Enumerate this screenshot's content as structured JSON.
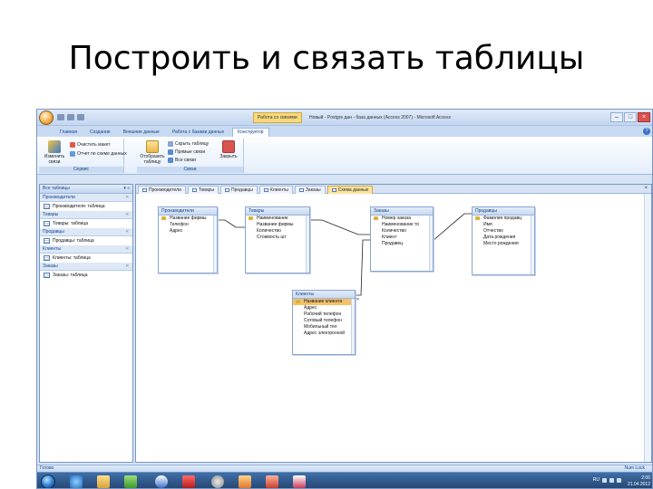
{
  "slide": {
    "title": "Построить и связать таблицы"
  },
  "window": {
    "context_tab_title": "Работа со связями",
    "title": "Новый - Postgre дан - база данных (Access 2007) - Microsoft Access",
    "controls": {
      "minimize": "–",
      "maximize": "□",
      "close": "×"
    }
  },
  "ribbon": {
    "tabs": [
      "Главная",
      "Создание",
      "Внешние данные",
      "Работа с базами данных",
      "Конструктор"
    ],
    "active_tab_index": 4,
    "help": "?",
    "groups": {
      "service": {
        "label": "Сервис",
        "change_links": "Изменить связи",
        "clear_layout": "Очистить макет",
        "relationship_report": "Отчет по схеме данных"
      },
      "relationships": {
        "label": "Связи",
        "show_table": "Отобразить таблицу",
        "hide_table": "Скрыть таблицу",
        "direct_links": "Прямые связи",
        "all_links": "Все связи",
        "close": "Закрыть"
      }
    }
  },
  "navpane": {
    "header": "Все таблицы",
    "header_ctrls": "▾ «",
    "groups": [
      {
        "name": "Производители",
        "items": [
          "Производители: таблица"
        ]
      },
      {
        "name": "Товары",
        "items": [
          "Товары: таблица"
        ]
      },
      {
        "name": "Продавцы",
        "items": [
          "Продавцы: таблица"
        ]
      },
      {
        "name": "Клиенты",
        "items": [
          "Клиенты: таблица"
        ]
      },
      {
        "name": "Заказы",
        "items": [
          "Заказы: таблица"
        ]
      }
    ]
  },
  "doc_tabs": [
    "Производители",
    "Товары",
    "Продавцы",
    "Клиенты",
    "Заказы",
    "Схема данных"
  ],
  "active_doc_tab_index": 5,
  "doc_close": "×",
  "tables": {
    "manufacturers": {
      "name": "Производители",
      "fields": [
        "Название фирмы",
        "Телефон",
        "Адрес"
      ]
    },
    "goods": {
      "name": "Товары",
      "fields": [
        "Наименование",
        "Название фирмы",
        "Количество",
        "Стоимость шт"
      ]
    },
    "orders": {
      "name": "Заказы",
      "fields": [
        "Номер заказа",
        "Наименование то",
        "Количество",
        "Клиент",
        "Продавец"
      ]
    },
    "sellers": {
      "name": "Продавцы",
      "fields": [
        "Фамилия продавц",
        "Имя",
        "Отчество",
        "Дата рождения",
        "Место рождения"
      ]
    },
    "clients": {
      "name": "Клиенты",
      "fields": [
        "Название клиента",
        "Адрес",
        "Рабочий телефон",
        "Сотовый телефон",
        "Мобильный тел",
        "Адрес электронной"
      ]
    }
  },
  "statusbar": {
    "left": "Готово",
    "right": "Num Lock"
  },
  "taskbar": {
    "lang": "RU",
    "time": "2:06",
    "date": "21.04.2012"
  },
  "colors": {
    "window_bg": "#d6e4f5",
    "accent": "#15428b",
    "context_tab": "#f7d97c",
    "selected_field": "#f5c16a"
  }
}
